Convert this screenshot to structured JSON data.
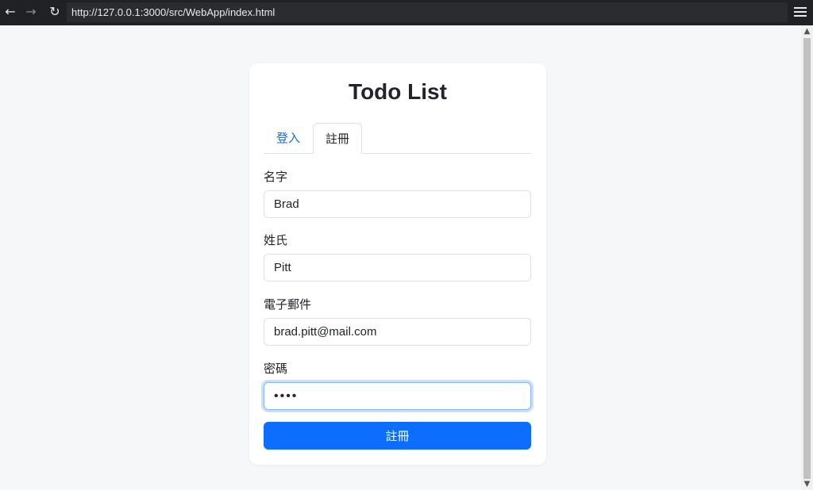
{
  "browser": {
    "url": "http://127.0.0.1:3000/src/WebApp/index.html",
    "back_glyph": "←",
    "forward_glyph": "→",
    "reload_glyph": "↻"
  },
  "app": {
    "title": "Todo List"
  },
  "tabs": [
    {
      "label": "登入",
      "active": false
    },
    {
      "label": "註冊",
      "active": true
    }
  ],
  "form": {
    "first_name": {
      "label": "名字",
      "value": "Brad"
    },
    "last_name": {
      "label": "姓氏",
      "value": "Pitt"
    },
    "email": {
      "label": "電子郵件",
      "value": "brad.pitt@mail.com"
    },
    "password": {
      "label": "密碼",
      "value": "1234",
      "focused": true
    },
    "submit_label": "註冊"
  },
  "colors": {
    "accent": "#0d6efd",
    "background": "#f6f7f9",
    "card": "#ffffff"
  }
}
